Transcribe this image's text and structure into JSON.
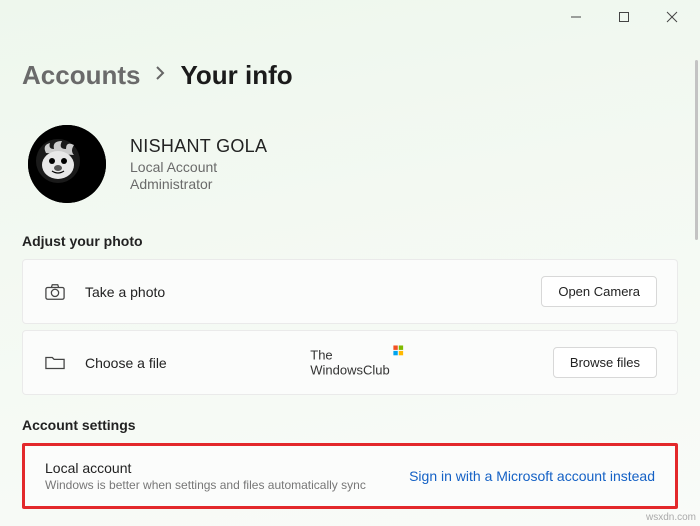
{
  "breadcrumb": {
    "parent": "Accounts",
    "current": "Your info"
  },
  "profile": {
    "name": "NISHANT GOLA",
    "type": "Local Account",
    "role": "Administrator"
  },
  "sections": {
    "photo_header": "Adjust your photo",
    "account_header": "Account settings"
  },
  "photo_rows": {
    "take": {
      "label": "Take a photo",
      "button": "Open Camera"
    },
    "choose": {
      "label": "Choose a file",
      "button": "Browse files"
    }
  },
  "account_row": {
    "title": "Local account",
    "desc": "Windows is better when settings and files automatically sync",
    "link": "Sign in with a Microsoft account instead"
  },
  "watermark": {
    "line1": "The",
    "line2": "WindowsClub"
  },
  "credit": "wsxdn.com"
}
